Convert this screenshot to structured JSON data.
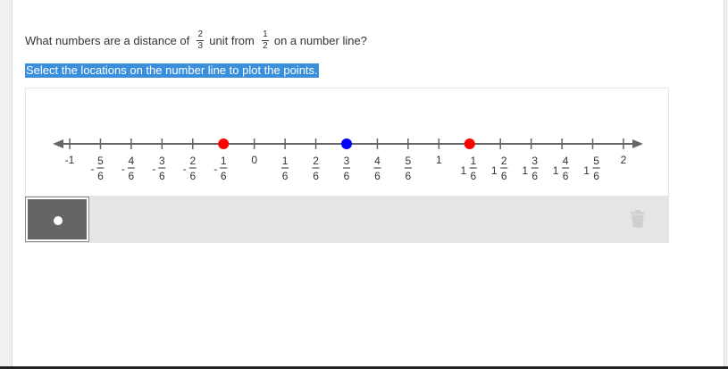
{
  "question": {
    "prefix": "What numbers are a distance of",
    "fraction1": {
      "num": "2",
      "den": "3"
    },
    "middle": "unit from",
    "fraction2": {
      "num": "1",
      "den": "2"
    },
    "suffix": "on a number line?"
  },
  "instruction": "Select the locations on the number line to plot the points.",
  "number_line": {
    "min": -1,
    "max": 2,
    "step_denominator": 6,
    "labels": [
      {
        "value": -1,
        "sign": "",
        "whole": "-1",
        "num": "",
        "den": ""
      },
      {
        "value": -0.8333,
        "sign": "-",
        "whole": "",
        "num": "5",
        "den": "6"
      },
      {
        "value": -0.6667,
        "sign": "-",
        "whole": "",
        "num": "4",
        "den": "6"
      },
      {
        "value": -0.5,
        "sign": "-",
        "whole": "",
        "num": "3",
        "den": "6"
      },
      {
        "value": -0.3333,
        "sign": "-",
        "whole": "",
        "num": "2",
        "den": "6"
      },
      {
        "value": -0.1667,
        "sign": "-",
        "whole": "",
        "num": "1",
        "den": "6"
      },
      {
        "value": 0,
        "sign": "",
        "whole": "0",
        "num": "",
        "den": ""
      },
      {
        "value": 0.1667,
        "sign": "",
        "whole": "",
        "num": "1",
        "den": "6"
      },
      {
        "value": 0.3333,
        "sign": "",
        "whole": "",
        "num": "2",
        "den": "6"
      },
      {
        "value": 0.5,
        "sign": "",
        "whole": "",
        "num": "3",
        "den": "6"
      },
      {
        "value": 0.6667,
        "sign": "",
        "whole": "",
        "num": "4",
        "den": "6"
      },
      {
        "value": 0.8333,
        "sign": "",
        "whole": "",
        "num": "5",
        "den": "6"
      },
      {
        "value": 1,
        "sign": "",
        "whole": "1",
        "num": "",
        "den": ""
      },
      {
        "value": 1.1667,
        "sign": "",
        "whole": "1",
        "num": "1",
        "den": "6"
      },
      {
        "value": 1.3333,
        "sign": "",
        "whole": "1",
        "num": "2",
        "den": "6"
      },
      {
        "value": 1.5,
        "sign": "",
        "whole": "1",
        "num": "3",
        "den": "6"
      },
      {
        "value": 1.6667,
        "sign": "",
        "whole": "1",
        "num": "4",
        "den": "6"
      },
      {
        "value": 1.8333,
        "sign": "",
        "whole": "1",
        "num": "5",
        "den": "6"
      },
      {
        "value": 2,
        "sign": "",
        "whole": "2",
        "num": "",
        "den": ""
      }
    ],
    "points": [
      {
        "value": -0.1667,
        "color": "#ff0000",
        "name": "point-red-left"
      },
      {
        "value": 0.5,
        "color": "#0000ff",
        "name": "point-blue"
      },
      {
        "value": 1.1667,
        "color": "#ff0000",
        "name": "point-red-right"
      }
    ]
  },
  "toolbar": {
    "tool": "point-tool",
    "delete_icon": "trash-icon"
  },
  "colors": {
    "highlight": "#3a8fdc",
    "axis": "#666666",
    "toolbar_bg": "#e5e5e5",
    "tool_bg": "#656565"
  }
}
